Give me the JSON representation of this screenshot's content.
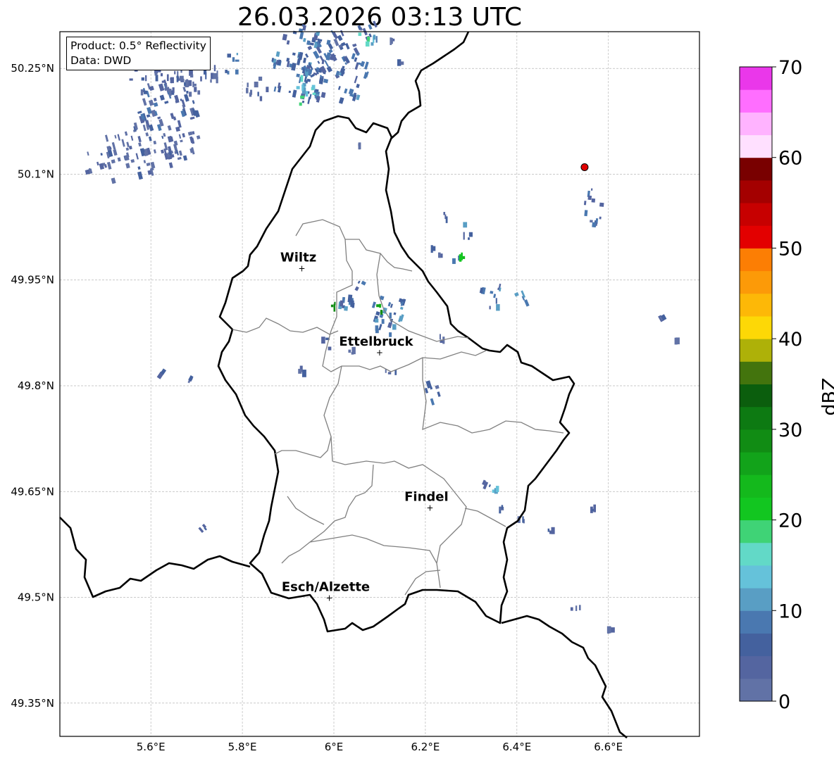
{
  "title": "26.03.2026 03:13 UTC",
  "info_box": {
    "product": "Product: 0.5° Reflectivity",
    "data": "Data: DWD"
  },
  "lat_ticks": [
    {
      "value": 50.25,
      "label": "50.25°N"
    },
    {
      "value": 50.1,
      "label": "50.1°N"
    },
    {
      "value": 49.95,
      "label": "49.95°N"
    },
    {
      "value": 49.8,
      "label": "49.8°N"
    },
    {
      "value": 49.65,
      "label": "49.65°N"
    },
    {
      "value": 49.5,
      "label": "49.5°N"
    },
    {
      "value": 49.35,
      "label": "49.35°N"
    }
  ],
  "lon_ticks": [
    {
      "value": 5.6,
      "label": "5.6°E"
    },
    {
      "value": 5.8,
      "label": "5.8°E"
    },
    {
      "value": 6.0,
      "label": "6°E"
    },
    {
      "value": 6.2,
      "label": "6.2°E"
    },
    {
      "value": 6.4,
      "label": "6.4°E"
    },
    {
      "value": 6.6,
      "label": "6.6°E"
    }
  ],
  "cities": [
    {
      "name": "Wiltz",
      "lon": 5.93,
      "lat": 49.966
    },
    {
      "name": "Ettelbruck",
      "lon": 6.1,
      "lat": 49.847
    },
    {
      "name": "Findel",
      "lon": 6.21,
      "lat": 49.627
    },
    {
      "name": "Esch/Alzette",
      "lon": 5.99,
      "lat": 49.499
    }
  ],
  "radar_site": {
    "lon": 6.548,
    "lat": 50.11,
    "color": "#e00000"
  },
  "colorbar": {
    "label": "dBZ",
    "min": 0,
    "max": 70,
    "step": 2.5,
    "ticks": [
      "0",
      "10",
      "20",
      "30",
      "40",
      "50",
      "60",
      "70"
    ],
    "colors": [
      "#6172a6",
      "#5465a0",
      "#44619e",
      "#4a78b0",
      "#599ec4",
      "#65c2da",
      "#62d9c7",
      "#3fd376",
      "#12c620",
      "#14b91c",
      "#12a31a",
      "#118c14",
      "#0d7a12",
      "#0b5e0d",
      "#43740d",
      "#aeb108",
      "#fdd806",
      "#fdb807",
      "#fc9a08",
      "#fc7e04",
      "#e30000",
      "#c70000",
      "#a40000",
      "#790000",
      "#ffe0ff",
      "#ffb3ff",
      "#ff6eff",
      "#ea37ea"
    ]
  }
}
